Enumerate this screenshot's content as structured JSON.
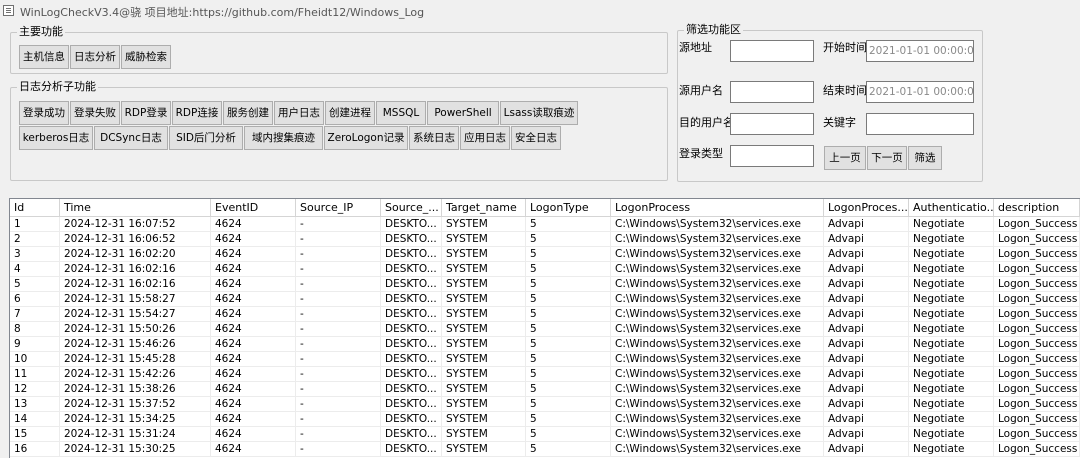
{
  "window": {
    "title": "WinLogCheckV3.4@骁 项目地址:https://github.com/Fheidt12/Windows_Log"
  },
  "main_group": {
    "title": "主要功能",
    "buttons": [
      "主机信息",
      "日志分析",
      "威胁检索"
    ]
  },
  "sub_group": {
    "title": "日志分析子功能",
    "row1": [
      "登录成功",
      "登录失败",
      "RDP登录",
      "RDP连接",
      "服务创建",
      "用户日志",
      "创建进程",
      "MSSQL",
      "PowerShell",
      "Lsass读取痕迹"
    ],
    "row2": [
      "kerberos日志",
      "DCSync日志",
      "SID后门分析",
      "域内搜集痕迹",
      "ZeroLogon记录",
      "系统日志",
      "应用日志",
      "安全日志"
    ]
  },
  "filter_group": {
    "title": "筛选功能区",
    "source_addr_label": "源地址",
    "start_time_label": "开始时间",
    "start_time_value": "2021-01-01 00:00:00",
    "source_user_label": "源用户名",
    "end_time_label": "结束时间",
    "end_time_value": "2021-01-01 00:00:00",
    "target_user_label": "目的用户名",
    "keyword_label": "关键字",
    "logon_type_label": "登录类型",
    "prev_label": "上一页",
    "next_label": "下一页",
    "filter_label": "筛选"
  },
  "table": {
    "columns": [
      "Id",
      "Time",
      "EventID",
      "Source_IP",
      "Source_...",
      "Target_name",
      "LogonType",
      "LogonProcess",
      "LogonProces...",
      "Authenticatio...",
      "description"
    ],
    "rows": [
      [
        "1",
        "2024-12-31 16:07:52",
        "4624",
        "-",
        "DESKTO...",
        "SYSTEM",
        "5",
        "C:\\Windows\\System32\\services.exe",
        "Advapi",
        "Negotiate",
        "Logon_Success"
      ],
      [
        "2",
        "2024-12-31 16:06:52",
        "4624",
        "-",
        "DESKTO...",
        "SYSTEM",
        "5",
        "C:\\Windows\\System32\\services.exe",
        "Advapi",
        "Negotiate",
        "Logon_Success"
      ],
      [
        "3",
        "2024-12-31 16:02:20",
        "4624",
        "-",
        "DESKTO...",
        "SYSTEM",
        "5",
        "C:\\Windows\\System32\\services.exe",
        "Advapi",
        "Negotiate",
        "Logon_Success"
      ],
      [
        "4",
        "2024-12-31 16:02:16",
        "4624",
        "-",
        "DESKTO...",
        "SYSTEM",
        "5",
        "C:\\Windows\\System32\\services.exe",
        "Advapi",
        "Negotiate",
        "Logon_Success"
      ],
      [
        "5",
        "2024-12-31 16:02:16",
        "4624",
        "-",
        "DESKTO...",
        "SYSTEM",
        "5",
        "C:\\Windows\\System32\\services.exe",
        "Advapi",
        "Negotiate",
        "Logon_Success"
      ],
      [
        "6",
        "2024-12-31 15:58:27",
        "4624",
        "-",
        "DESKTO...",
        "SYSTEM",
        "5",
        "C:\\Windows\\System32\\services.exe",
        "Advapi",
        "Negotiate",
        "Logon_Success"
      ],
      [
        "7",
        "2024-12-31 15:54:27",
        "4624",
        "-",
        "DESKTO...",
        "SYSTEM",
        "5",
        "C:\\Windows\\System32\\services.exe",
        "Advapi",
        "Negotiate",
        "Logon_Success"
      ],
      [
        "8",
        "2024-12-31 15:50:26",
        "4624",
        "-",
        "DESKTO...",
        "SYSTEM",
        "5",
        "C:\\Windows\\System32\\services.exe",
        "Advapi",
        "Negotiate",
        "Logon_Success"
      ],
      [
        "9",
        "2024-12-31 15:46:26",
        "4624",
        "-",
        "DESKTO...",
        "SYSTEM",
        "5",
        "C:\\Windows\\System32\\services.exe",
        "Advapi",
        "Negotiate",
        "Logon_Success"
      ],
      [
        "10",
        "2024-12-31 15:45:28",
        "4624",
        "-",
        "DESKTO...",
        "SYSTEM",
        "5",
        "C:\\Windows\\System32\\services.exe",
        "Advapi",
        "Negotiate",
        "Logon_Success"
      ],
      [
        "11",
        "2024-12-31 15:42:26",
        "4624",
        "-",
        "DESKTO...",
        "SYSTEM",
        "5",
        "C:\\Windows\\System32\\services.exe",
        "Advapi",
        "Negotiate",
        "Logon_Success"
      ],
      [
        "12",
        "2024-12-31 15:38:26",
        "4624",
        "-",
        "DESKTO...",
        "SYSTEM",
        "5",
        "C:\\Windows\\System32\\services.exe",
        "Advapi",
        "Negotiate",
        "Logon_Success"
      ],
      [
        "13",
        "2024-12-31 15:37:52",
        "4624",
        "-",
        "DESKTO...",
        "SYSTEM",
        "5",
        "C:\\Windows\\System32\\services.exe",
        "Advapi",
        "Negotiate",
        "Logon_Success"
      ],
      [
        "14",
        "2024-12-31 15:34:25",
        "4624",
        "-",
        "DESKTO...",
        "SYSTEM",
        "5",
        "C:\\Windows\\System32\\services.exe",
        "Advapi",
        "Negotiate",
        "Logon_Success"
      ],
      [
        "15",
        "2024-12-31 15:31:24",
        "4624",
        "-",
        "DESKTO...",
        "SYSTEM",
        "5",
        "C:\\Windows\\System32\\services.exe",
        "Advapi",
        "Negotiate",
        "Logon_Success"
      ],
      [
        "16",
        "2024-12-31 15:30:25",
        "4624",
        "-",
        "DESKTO...",
        "SYSTEM",
        "5",
        "C:\\Windows\\System32\\services.exe",
        "Advapi",
        "Negotiate",
        "Logon_Success"
      ]
    ]
  }
}
